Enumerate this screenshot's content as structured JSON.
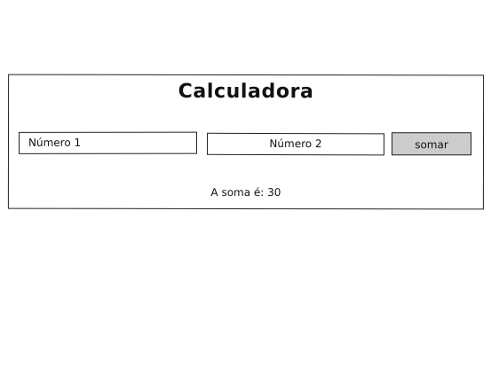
{
  "app": {
    "title": "Calculadora"
  },
  "inputs": {
    "numero1": {
      "placeholder": "Número 1",
      "value": ""
    },
    "numero2": {
      "placeholder": "Número 2",
      "value": ""
    }
  },
  "actions": {
    "somar_label": "somar"
  },
  "result": {
    "text": "A soma é: 30"
  },
  "colors": {
    "button_bg": "#cccccc",
    "border": "#222222",
    "background": "#ffffff"
  }
}
